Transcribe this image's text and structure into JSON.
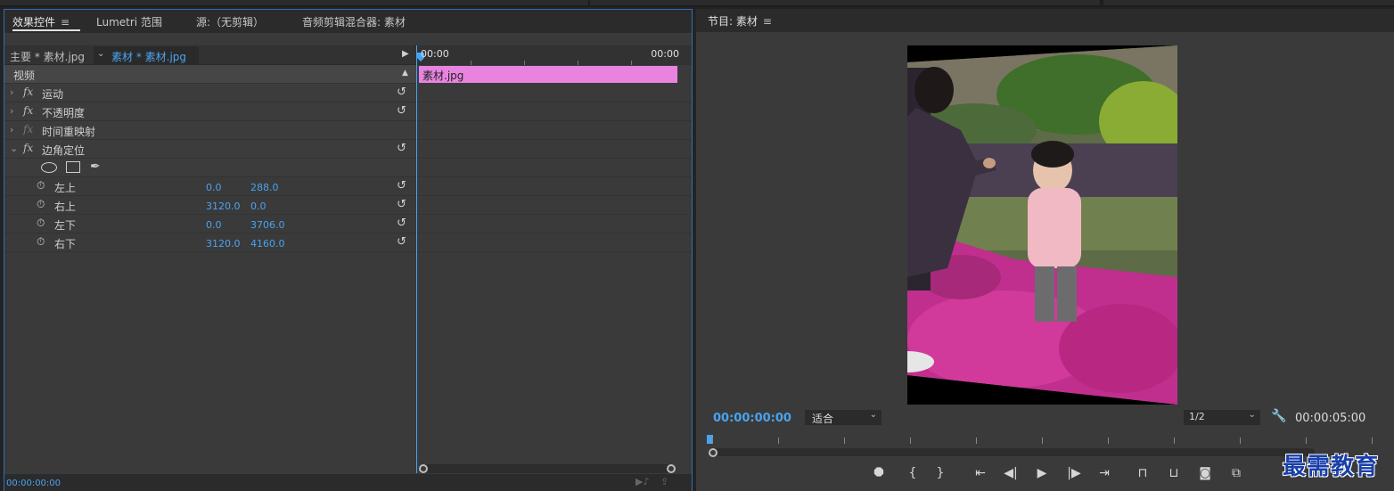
{
  "tabs": {
    "effect_controls": "效果控件",
    "lumetri": "Lumetri 范围",
    "source": "源:（无剪辑）",
    "audio_mixer": "音频剪辑混合器: 素材",
    "menu_glyph": "≡"
  },
  "effect_controls": {
    "master_label": "主要 * 素材.jpg",
    "clip_label": "素材 * 素材.jpg",
    "section_video": "视频",
    "effects": [
      {
        "name": "运动",
        "fx": "fx"
      },
      {
        "name": "不透明度",
        "fx": "fx"
      },
      {
        "name": "时间重映射",
        "fx": "fx"
      },
      {
        "name": "边角定位",
        "fx": "fx"
      }
    ],
    "params": [
      {
        "label": "左上",
        "x": "0.0",
        "y": "288.0"
      },
      {
        "label": "右上",
        "x": "3120.0",
        "y": "0.0"
      },
      {
        "label": "左下",
        "x": "0.0",
        "y": "3706.0"
      },
      {
        "label": "右下",
        "x": "3120.0",
        "y": "4160.0"
      }
    ],
    "footer_timecode": "00:00:00:00"
  },
  "timeline": {
    "start": "00:00",
    "end": "00:00",
    "clip_name": "素材.jpg",
    "clip_color": "#e884e0"
  },
  "program": {
    "title": "节目: 素材",
    "timecode": "00:00:00:00",
    "zoom": "适合",
    "resolution": "1/2",
    "duration": "00:00:05:00"
  },
  "watermark": "最需教育",
  "colors": {
    "accent": "#4aa3f0",
    "panel_bg": "#3a3a3a",
    "tab_bg": "#2b2b2b"
  },
  "icons": {
    "reset": "reset-icon",
    "stopwatch": "stopwatch-icon",
    "wrench": "wrench-icon"
  }
}
